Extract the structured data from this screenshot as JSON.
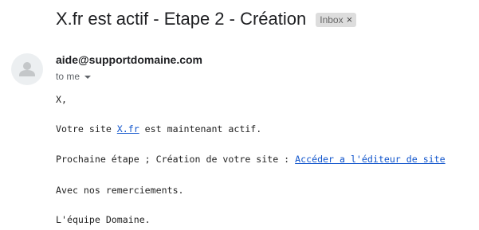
{
  "email": {
    "subject": "X.fr est actif - Etape 2 - Création",
    "label_chip": "Inbox",
    "label_chip_close": "×",
    "sender": "aide@supportdomaine.com",
    "recipient": "to me",
    "greeting": "X,",
    "line2_prefix": "Votre site ",
    "line2_link": "X.fr",
    "line2_suffix": " est maintenant actif.",
    "line3_prefix": "Prochaine étape ; Création de votre site : ",
    "line3_link": "Accéder a l'éditeur de site",
    "thanks": "Avec nos remerciements.",
    "signature": "L'équipe Domaine."
  },
  "icons": {
    "avatar": "person-icon",
    "chip_close": "close-icon",
    "recipient_details": "chevron-down-icon"
  },
  "colors": {
    "link": "#1155cc",
    "chip_bg": "#dddddd",
    "avatar_bg": "#eceff1"
  }
}
